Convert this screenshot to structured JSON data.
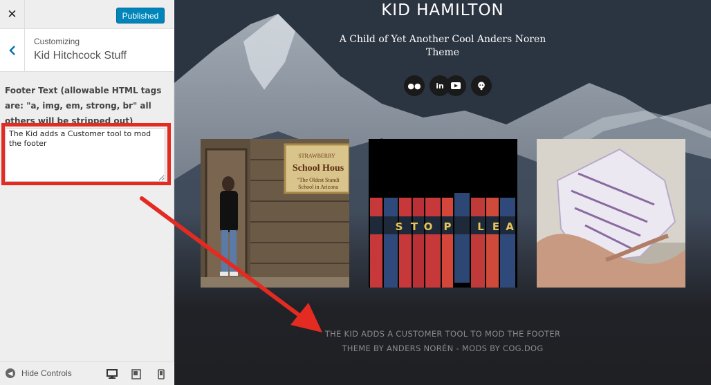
{
  "colors": {
    "accent": "#0085ba",
    "annotation": "#e32b22",
    "sidebar_bg": "#eeeeee"
  },
  "customizer": {
    "close_icon": "close-icon",
    "publish_label": "Published",
    "customizing_label": "Customizing",
    "section_title": "Kid Hitchcock Stuff",
    "control_label": "Footer Text (allowable HTML tags are: \"a, img, em, strong, br\" all others will be stripped out)",
    "footer_text_value": "The Kid adds a Customer tool to mod the footer",
    "hide_controls_label": "Hide Controls",
    "devices": [
      "desktop-icon",
      "tablet-icon",
      "mobile-icon"
    ]
  },
  "preview": {
    "site_title": "KID HAMILTON",
    "site_description": "A Child of Yet Another Cool Anders Noren Theme",
    "social_icons": [
      "flickr-icon",
      "linkedin-icon",
      "youtube-icon",
      "github-icon"
    ],
    "social_glyphs": [
      "●●",
      "in",
      "You",
      "⌥"
    ],
    "posts": [
      {
        "name": "schoolhouse-photo",
        "sign_line1": "STRAWBERRY",
        "sign_line2": "School Hous",
        "sign_line3": "\"The Oldest Standi",
        "sign_line4": "School in Arizona"
      },
      {
        "name": "books-photo",
        "letters": [
          "S",
          "T",
          "O",
          "P",
          "L",
          "E",
          "A"
        ]
      },
      {
        "name": "wrapped-package-photo"
      }
    ],
    "footer_text": "THE KID ADDS A CUSTOMER TOOL TO MOD THE FOOTER",
    "credits": "THEME BY ANDERS NORÉN - MODS BY COG.DOG"
  }
}
